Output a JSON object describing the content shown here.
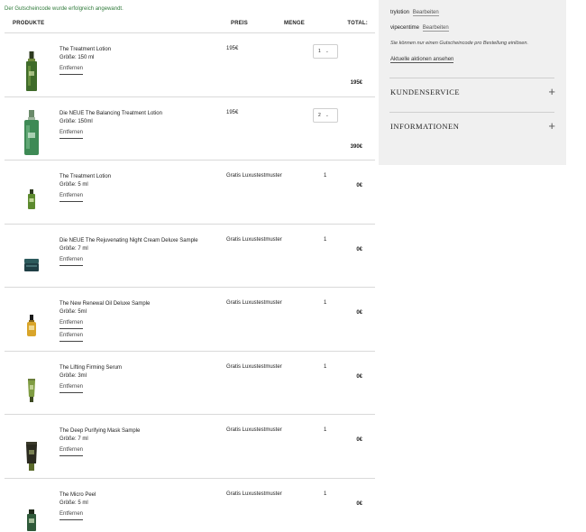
{
  "message": "Der Gutscheincode wurde erfolgreich angewandt.",
  "table_headers": {
    "product": "PRODUKTE",
    "price": "PREIS",
    "quantity": "MENGE",
    "total": "TOTAL:"
  },
  "remove_label": "Entfernen",
  "items": [
    {
      "name": "The Treatment Lotion",
      "size": "Größe: 150 ml",
      "price": "195€",
      "qty": "1",
      "total": "195€",
      "icon": "tall-green-bottle-icon"
    },
    {
      "name": "Die NEUE The Balancing Treatment Lotion",
      "size": "Größe: 150ml",
      "price": "195€",
      "qty": "2",
      "total": "390€",
      "icon": "tall-green-bottle-icon"
    },
    {
      "name": "The Treatment Lotion",
      "size": "Größe: 5 ml",
      "price": "Gratis Luxustestmuster",
      "qty": "1",
      "total": "0€",
      "icon": "small-green-bottle-icon"
    },
    {
      "name": "Die NEUE The Rejuvenating Night Cream Deluxe Sample",
      "size": "Größe: 7 ml",
      "price": "Gratis Luxustestmuster",
      "qty": "1",
      "total": "0€",
      "icon": "cream-jar-icon"
    },
    {
      "name": "The New Renewal Oil Deluxe Sample",
      "size": "Größe: 5ml",
      "price": "Gratis Luxustestmuster",
      "qty": "1",
      "total": "0€",
      "icon": "oil-dropper-bottle-icon"
    },
    {
      "name": "The Lifting Firming Serum",
      "size": "Größe: 3ml",
      "price": "Gratis Luxustestmuster",
      "qty": "1",
      "total": "0€",
      "icon": "serum-tube-icon"
    },
    {
      "name": "The Deep Purifying Mask Sample",
      "size": "Größe: 7 ml",
      "price": "Gratis Luxustestmuster",
      "qty": "1",
      "total": "0€",
      "icon": "mask-tube-icon"
    },
    {
      "name": "The Micro Peel",
      "size": "Größe: 5 ml",
      "price": "Gratis Luxustestmuster",
      "qty": "1",
      "total": "0€",
      "icon": "micro-peel-bottle-icon"
    }
  ],
  "sidebar": {
    "codes": [
      {
        "code": "trylotion",
        "edit": "Bearbeiten"
      },
      {
        "code": "vipecentime",
        "edit": "Bearbeiten"
      }
    ],
    "note": "Sie können nur einen Gutscheincode pro Bestellung einlösen.",
    "promotions_link": "Aktuelle aktionen ansehen",
    "accordions": [
      {
        "title": "KUNDENSERVICE",
        "icon": "plus-icon"
      },
      {
        "title": "INFORMATIONEN",
        "icon": "plus-icon"
      }
    ]
  },
  "colors": {
    "success_text": "#2f7a3a",
    "sidebar_bg": "#f0f0f0",
    "bottle_green": "#3f6b2a"
  }
}
